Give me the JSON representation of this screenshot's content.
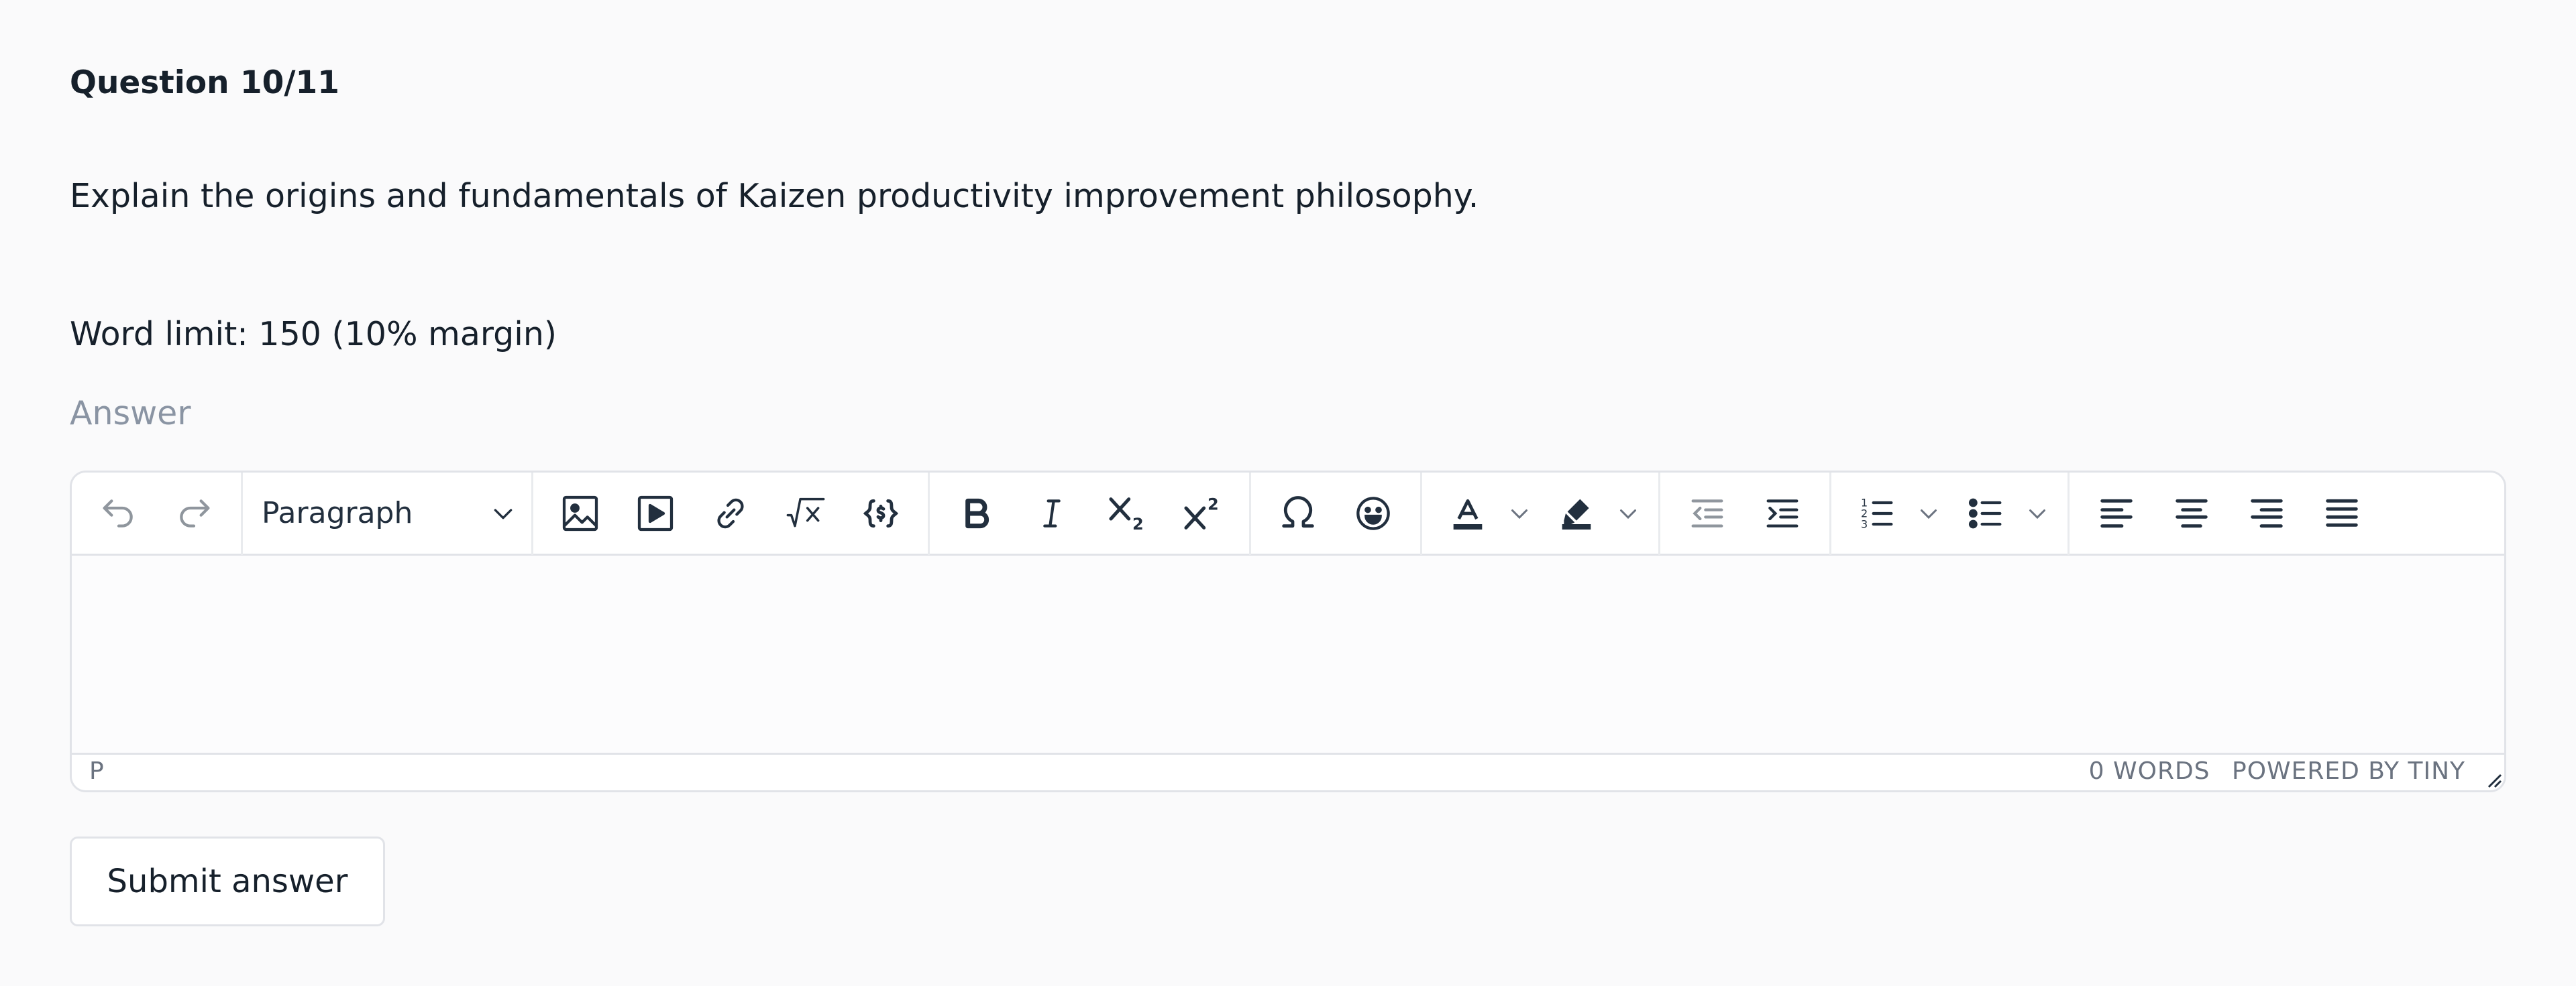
{
  "question": {
    "title": "Question 10/11",
    "text": "Explain the origins and fundamentals of Kaizen productivity improvement philosophy.",
    "word_limit": "Word limit: 150 (10% margin)",
    "answer_label": "Answer"
  },
  "editor": {
    "block_format": "Paragraph",
    "toolbar_icons": [
      "undo-icon",
      "redo-icon",
      "image-icon",
      "media-icon",
      "link-icon",
      "math-icon",
      "code-sample-icon",
      "bold-icon",
      "italic-icon",
      "subscript-icon",
      "superscript-icon",
      "special-char-icon",
      "emoji-icon",
      "text-color-icon",
      "highlight-icon",
      "outdent-icon",
      "indent-icon",
      "numbered-list-icon",
      "bullet-list-icon",
      "align-left-icon",
      "align-center-icon",
      "align-right-icon",
      "align-justify-icon"
    ],
    "status_path": "P",
    "word_count": "0 WORDS",
    "branding": "POWERED BY TINY"
  },
  "submit_label": "Submit answer",
  "colors": {
    "text": "#16202b",
    "muted": "#8a94a3",
    "border": "#e1e3e8",
    "icon": "#222f3e"
  }
}
